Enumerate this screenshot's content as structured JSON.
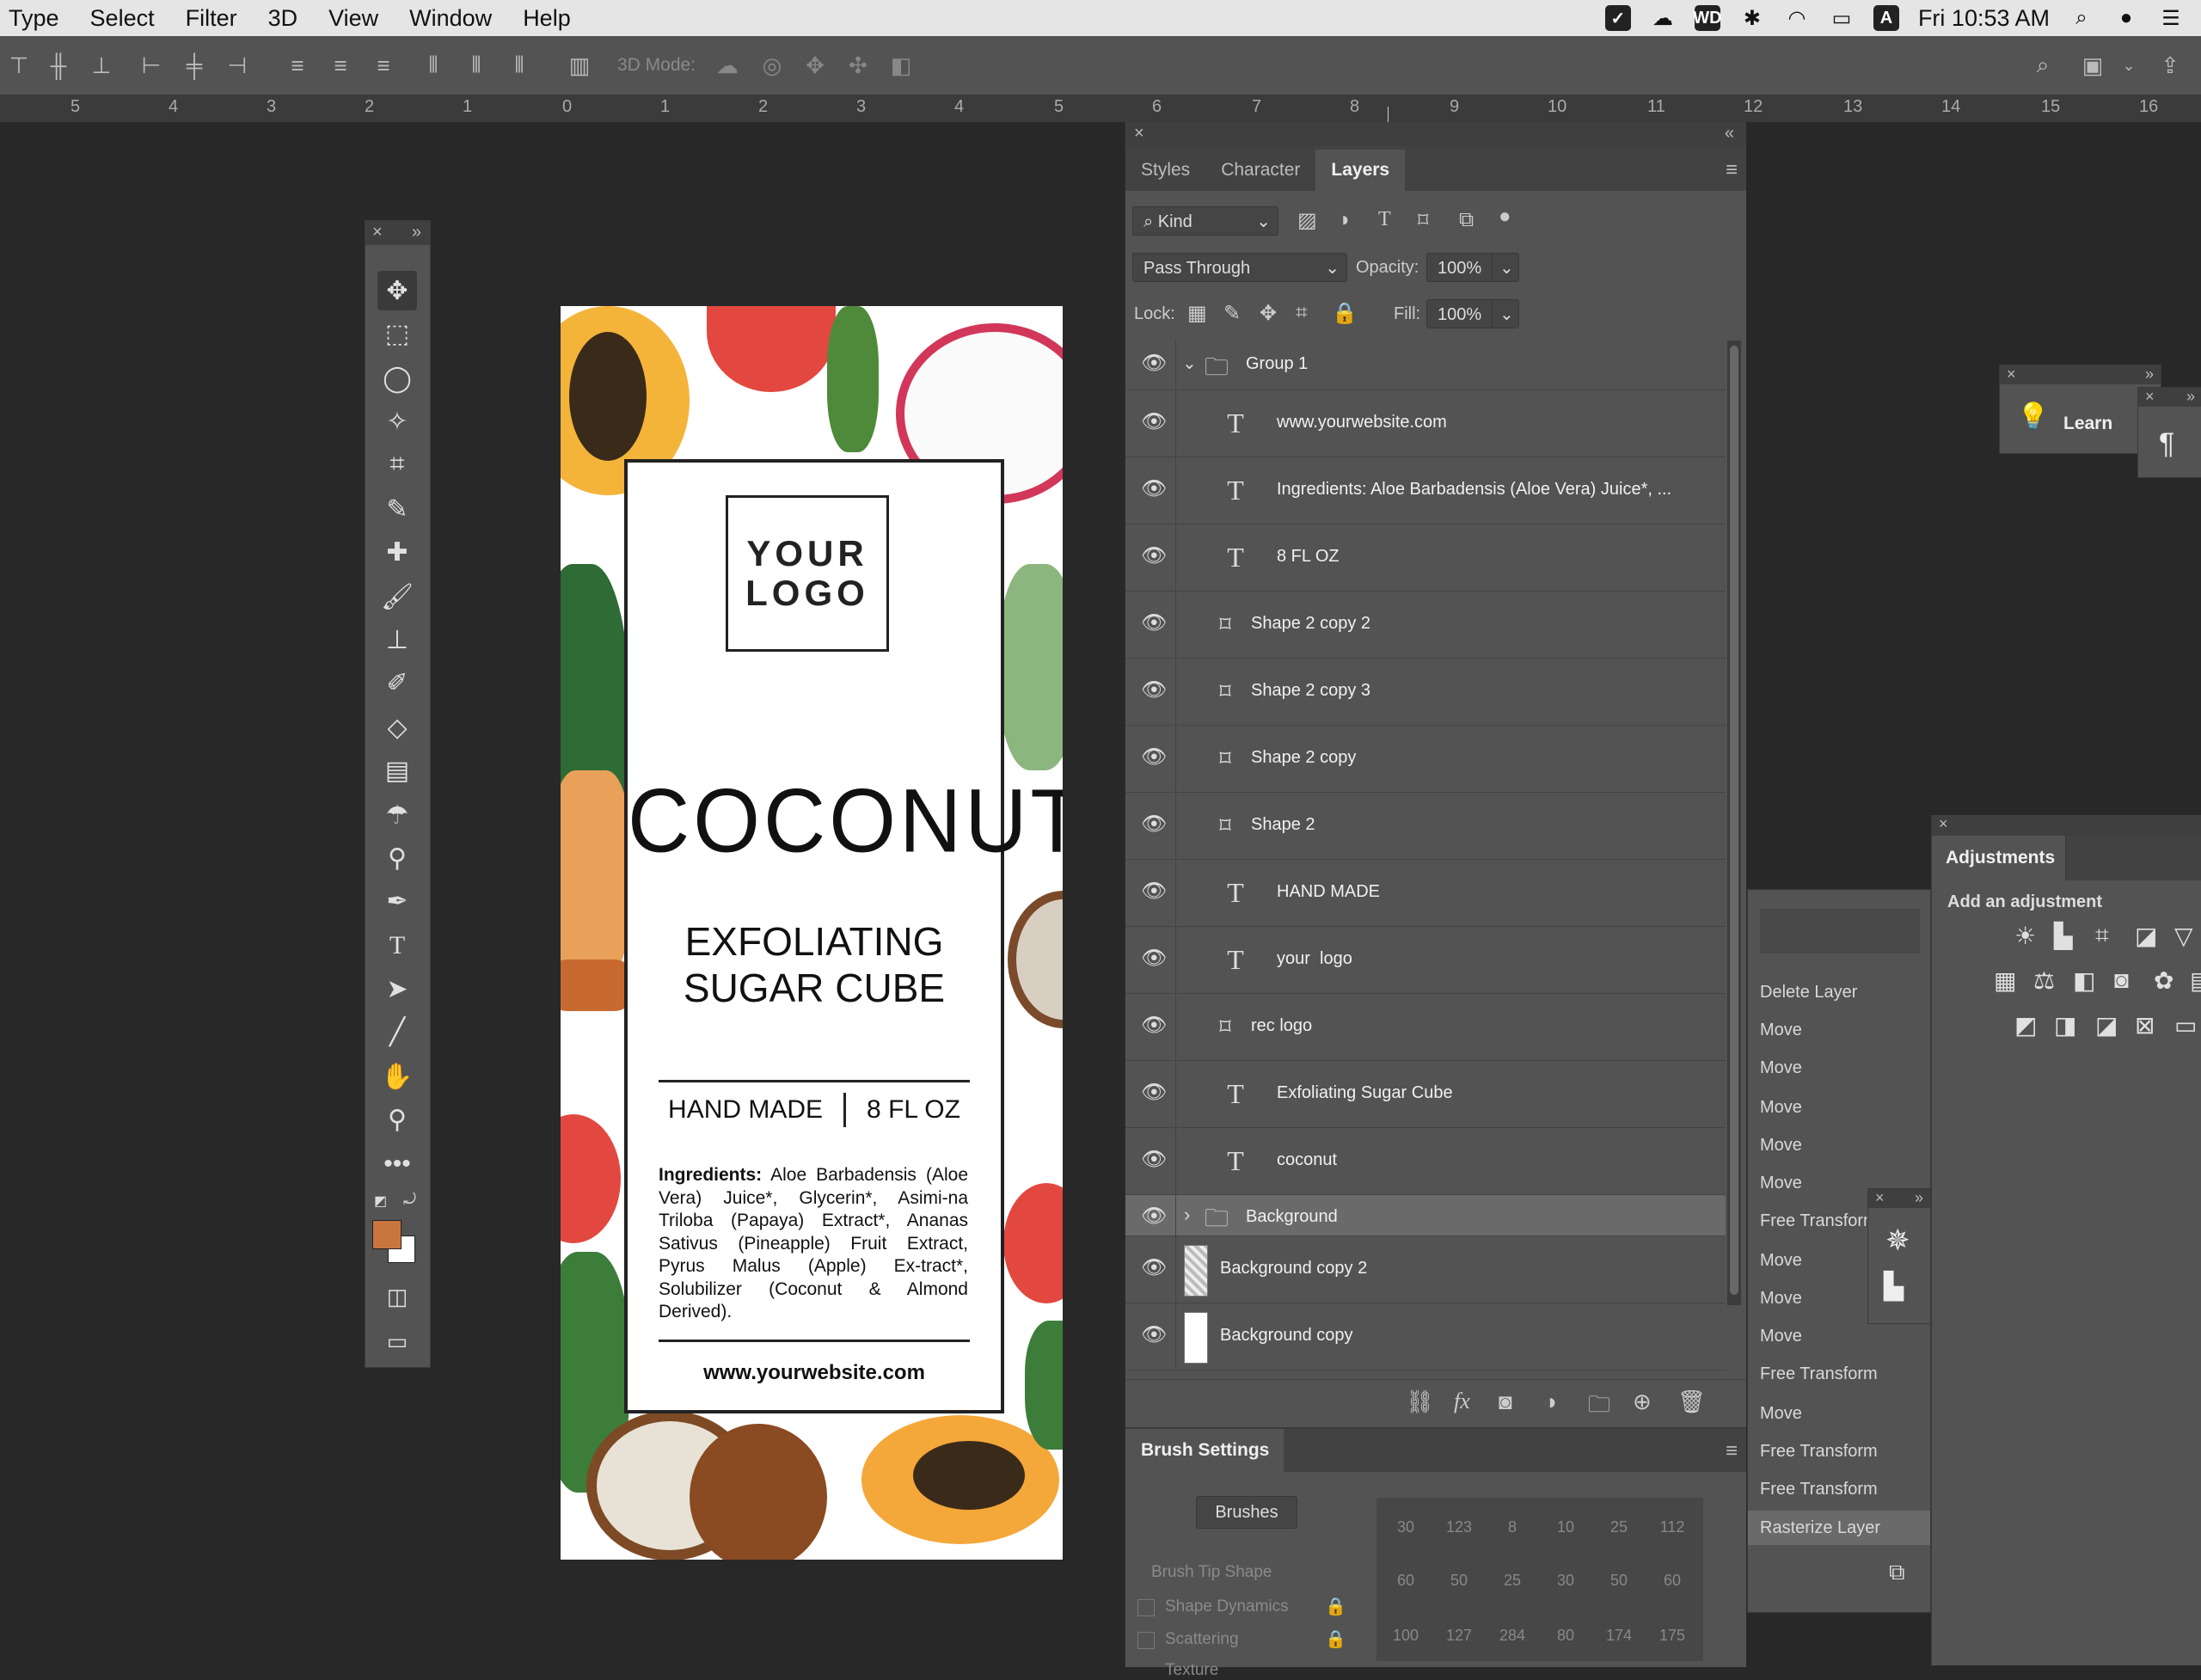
{
  "menubar": {
    "items": [
      "Type",
      "Select",
      "Filter",
      "3D",
      "View",
      "Window",
      "Help"
    ],
    "clock": "Fri 10:53 AM",
    "input_indicator": "A",
    "wd_label": "WD"
  },
  "options_bar": {
    "mode_label": "3D Mode:"
  },
  "ruler": {
    "labels": [
      "5",
      "4",
      "3",
      "2",
      "1",
      "0",
      "1",
      "2",
      "3",
      "4",
      "5",
      "6",
      "7",
      "8",
      "9",
      "10",
      "11",
      "12",
      "13",
      "14",
      "15",
      "16"
    ]
  },
  "document": {
    "logo_line1": "YOUR",
    "logo_line2": "LOGO",
    "product": "COCONUT",
    "subtitle_line1": "EXFOLIATING",
    "subtitle_line2": "SUGAR CUBE",
    "hand_made": "HAND MADE",
    "volume": "8 FL OZ",
    "ingredients_label": "Ingredients:",
    "ingredients_text": " Aloe Barbadensis (Aloe Vera) Juice*, Glycerin*, Asimi-na Triloba (Papaya) Extract*, Ananas Sativus (Pineapple) Fruit Extract, Pyrus Malus (Apple) Ex-tract*, Solubilizer (Coconut & Almond Derived).",
    "website": "www.yourwebsite.com"
  },
  "layers_panel": {
    "tabs": [
      "Styles",
      "Character",
      "Layers"
    ],
    "active_tab": "Layers",
    "filter_kind": "Kind",
    "blend_mode": "Pass Through",
    "opacity_label": "Opacity:",
    "opacity_value": "100%",
    "lock_label": "Lock:",
    "fill_label": "Fill:",
    "fill_value": "100%",
    "layers": [
      {
        "name": "Group 1",
        "type": "group",
        "indent": 0
      },
      {
        "name": "www.yourwebsite.com",
        "type": "text",
        "indent": 1
      },
      {
        "name": "Ingredients: Aloe Barbadensis (Aloe Vera) Juice*, ...",
        "type": "text",
        "indent": 1
      },
      {
        "name": "8 FL OZ",
        "type": "text",
        "indent": 1
      },
      {
        "name": "Shape 2 copy 2",
        "type": "shape",
        "indent": 1
      },
      {
        "name": "Shape 2 copy 3",
        "type": "shape",
        "indent": 1
      },
      {
        "name": "Shape 2 copy",
        "type": "shape",
        "indent": 1
      },
      {
        "name": "Shape 2",
        "type": "shape",
        "indent": 1
      },
      {
        "name": "HAND MADE",
        "type": "text",
        "indent": 1
      },
      {
        "name": "your  logo",
        "type": "text",
        "indent": 1
      },
      {
        "name": "rec logo",
        "type": "shape",
        "indent": 1
      },
      {
        "name": "Exfoliating Sugar Cube",
        "type": "text",
        "indent": 1
      },
      {
        "name": "coconut",
        "type": "text",
        "indent": 1
      },
      {
        "name": "Background",
        "type": "group-collapsed",
        "indent": 0
      },
      {
        "name": "Background copy 2",
        "type": "pixel-transparent",
        "indent": 0
      },
      {
        "name": "Background copy",
        "type": "pixel",
        "indent": 0
      }
    ]
  },
  "brush_settings": {
    "title": "Brush Settings",
    "brushes_button": "Brushes",
    "options": [
      "Brush Tip Shape",
      "Shape Dynamics",
      "Scattering",
      "Texture"
    ],
    "sizes_row1": [
      "30",
      "123",
      "8",
      "10",
      "25",
      "112"
    ],
    "sizes_row2": [
      "60",
      "50",
      "25",
      "30",
      "50",
      "60"
    ],
    "sizes_row3": [
      "100",
      "127",
      "284",
      "80",
      "174",
      "175"
    ]
  },
  "learn_panel": {
    "label": "Learn"
  },
  "history": {
    "items": [
      "Delete Layer",
      "Move",
      "Move",
      "Move",
      "Move",
      "Move",
      "Free Transform",
      "Move",
      "Move",
      "Move",
      "Free Transform",
      "Move",
      "Free Transform",
      "Free Transform",
      "Rasterize Layer"
    ]
  },
  "adjustments": {
    "tab": "Adjustments",
    "subtitle": "Add an adjustment"
  },
  "colors": {
    "foreground": "#c8763e",
    "background": "#ffffff",
    "panel": "#535353",
    "selected_row": "#6a6a6a"
  }
}
